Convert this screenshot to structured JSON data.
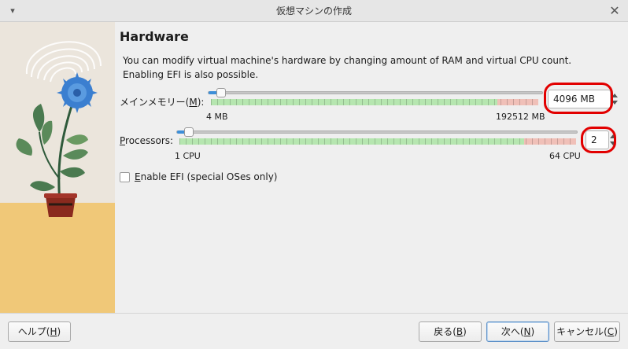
{
  "window": {
    "title": "仮想マシンの作成",
    "close_glyph": "✕",
    "caret_glyph": "▾"
  },
  "page": {
    "heading": "Hardware",
    "description_line1": "You can modify virtual machine's hardware by changing amount of RAM and virtual CPU count.",
    "description_line2": "Enabling EFI is also possible."
  },
  "memory": {
    "label_prefix": "メインメモリー(",
    "label_mnemonic": "M",
    "label_suffix": "):",
    "value": "4096 MB",
    "value_mb": 4096,
    "min_label": "4 MB",
    "max_label": "192512 MB",
    "min": 4,
    "max": 192512,
    "recommended_fraction": 0.875
  },
  "processors": {
    "label_mnemonic": "P",
    "label_rest": "rocessors:",
    "value": "2",
    "value_count": 2,
    "min_label": "1 CPU",
    "max_label": "64 CPU",
    "min": 1,
    "max": 64,
    "recommended_fraction": 0.87
  },
  "efi": {
    "label_mnemonic": "E",
    "label_rest": "nable EFI (special OSes only)",
    "checked": false
  },
  "buttons": {
    "help_prefix": "ヘルプ(",
    "help_mnemonic": "H",
    "help_suffix": ")",
    "back_prefix": "戻る(",
    "back_mnemonic": "B",
    "back_suffix": ")",
    "next_prefix": "次へ(",
    "next_mnemonic": "N",
    "next_suffix": ")",
    "cancel_prefix": "キャンセル(",
    "cancel_mnemonic": "C",
    "cancel_suffix": ")"
  },
  "colors": {
    "slider_fill": "#3d8fd8",
    "range_ok": "#b6e6b0",
    "range_bad": "#f0c0b8",
    "annotation": "#e20000"
  }
}
